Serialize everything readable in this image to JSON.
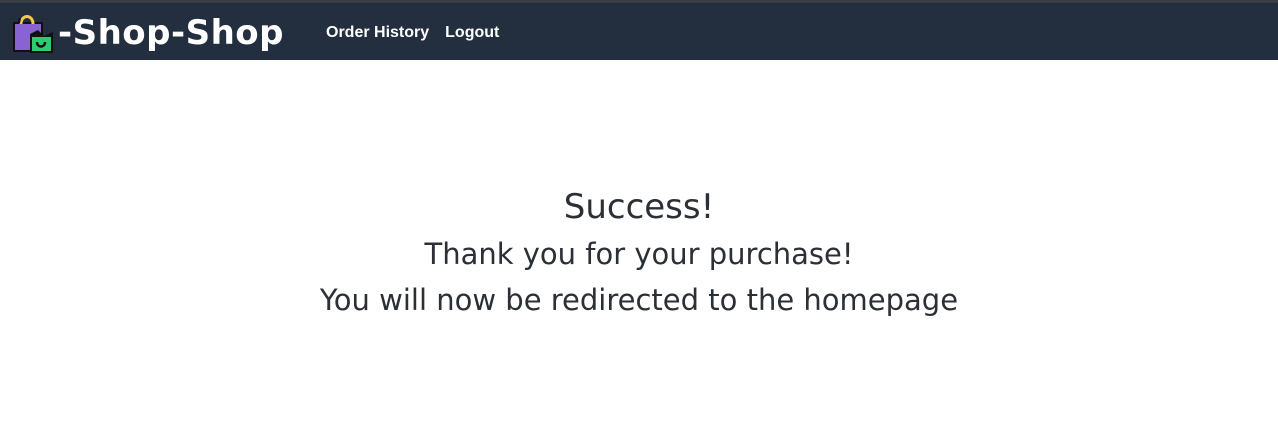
{
  "header": {
    "logo_icon": "shopping-bag-icon",
    "brand_title": "-Shop-Shop",
    "nav": {
      "order_history_label": "Order History",
      "logout_label": "Logout"
    },
    "colors": {
      "header_bg": "#232f3e",
      "header_text": "#ffffff"
    }
  },
  "main": {
    "heading": "Success!",
    "message": "Thank you for your purchase!",
    "redirect_message": "You will now be redirected to the homepage"
  }
}
